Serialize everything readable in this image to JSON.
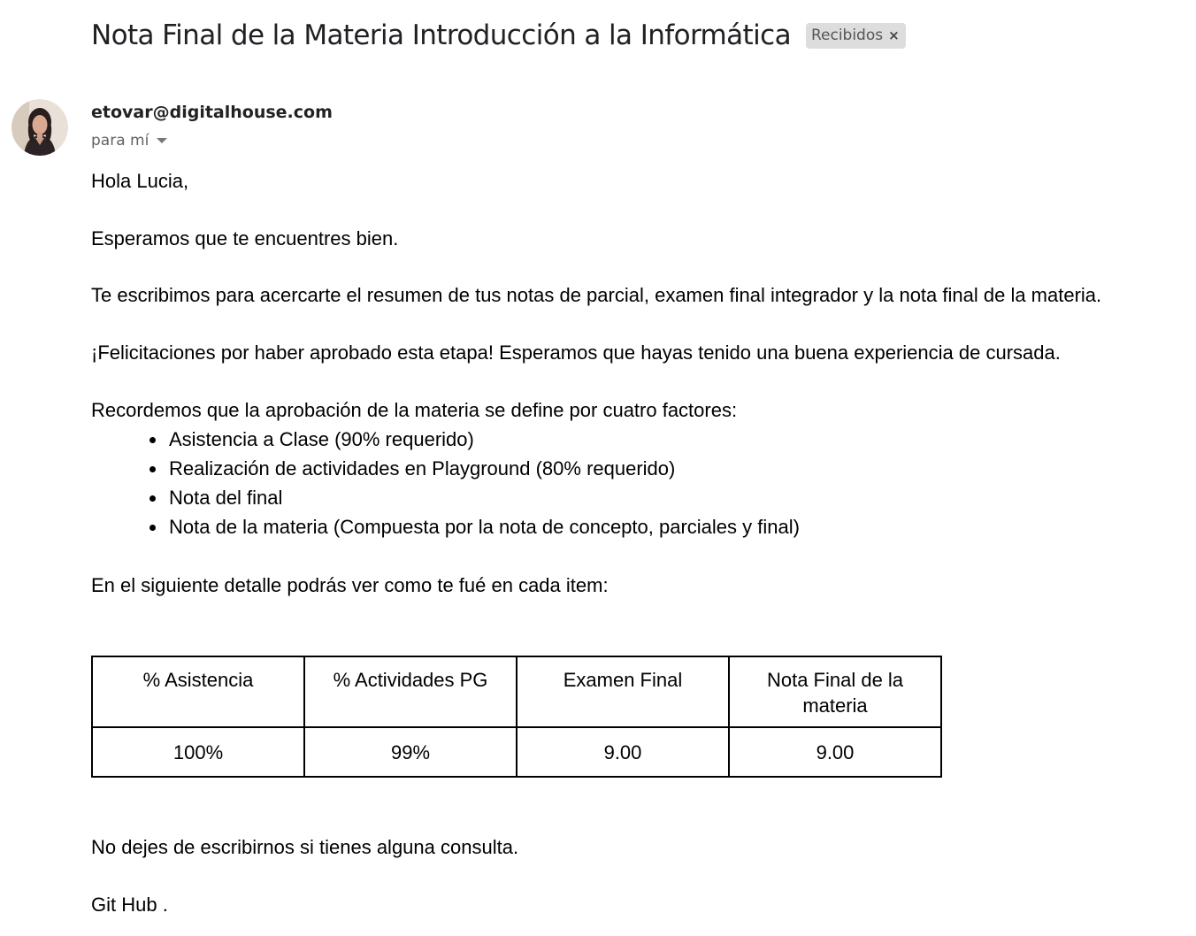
{
  "subject": "Nota Final de la Materia Introducción a la Informática",
  "label": {
    "text": "Recibidos",
    "close_glyph": "×"
  },
  "sender": {
    "email": "etovar@digitalhouse.com",
    "recipient": "para mí",
    "avatar": "avatar-photo"
  },
  "body": {
    "greeting": "Hola Lucia,",
    "p1": "Esperamos que te encuentres bien.",
    "p2": "Te escribimos para acercarte el resumen de tus notas de parcial, examen final integrador y la nota final de la materia.",
    "p3": "¡Felicitaciones por haber aprobado esta etapa! Esperamos que hayas tenido una buena experiencia de cursada.",
    "p4": "Recordemos que la aprobación de la materia se define por cuatro factores:",
    "bullets": [
      "Asistencia a Clase (90% requerido)",
      "Realización de actividades en Playground (80% requerido)",
      "Nota del final",
      "Nota de la materia (Compuesta por la nota de concepto, parciales y final)"
    ],
    "p5": "En el siguiente detalle podrás ver como te fué en cada item:",
    "p6": "No dejes de escribirnos si tienes alguna consulta.",
    "signature": "Git Hub ."
  },
  "grades_table": {
    "headers": [
      "% Asistencia",
      "% Actividades PG",
      "Examen Final",
      "Nota Final de la materia"
    ],
    "values": [
      "100%",
      "99%",
      "9.00",
      "9.00"
    ]
  },
  "colors": {
    "chip_bg": "#dddddd",
    "subject": "#202124",
    "meta": "#5f6368"
  }
}
